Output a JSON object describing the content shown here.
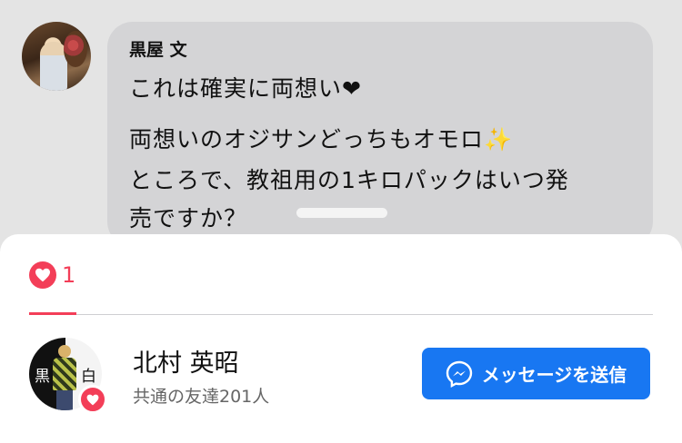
{
  "comment": {
    "author": "黒屋 文",
    "lines": [
      "これは確実に両想い",
      "両想いのオジサンどっちもオモロ",
      "ところで、教祖用の1キロパックはいつ発",
      "売ですか？"
    ],
    "line1_emoji": "❤",
    "line2_emoji": "✨"
  },
  "reactions": {
    "tab_count": "1",
    "icon": "heart-icon"
  },
  "user": {
    "name": "北村 英昭",
    "mutual_friends": "共通の友達201人",
    "avatar_text_left": "黒",
    "avatar_text_right": "白"
  },
  "actions": {
    "message_button_label": "メッセージを送信",
    "message_icon": "messenger-icon"
  },
  "colors": {
    "accent": "#1877f2",
    "heart": "#f33e58",
    "bubble": "#d4d4d6"
  }
}
